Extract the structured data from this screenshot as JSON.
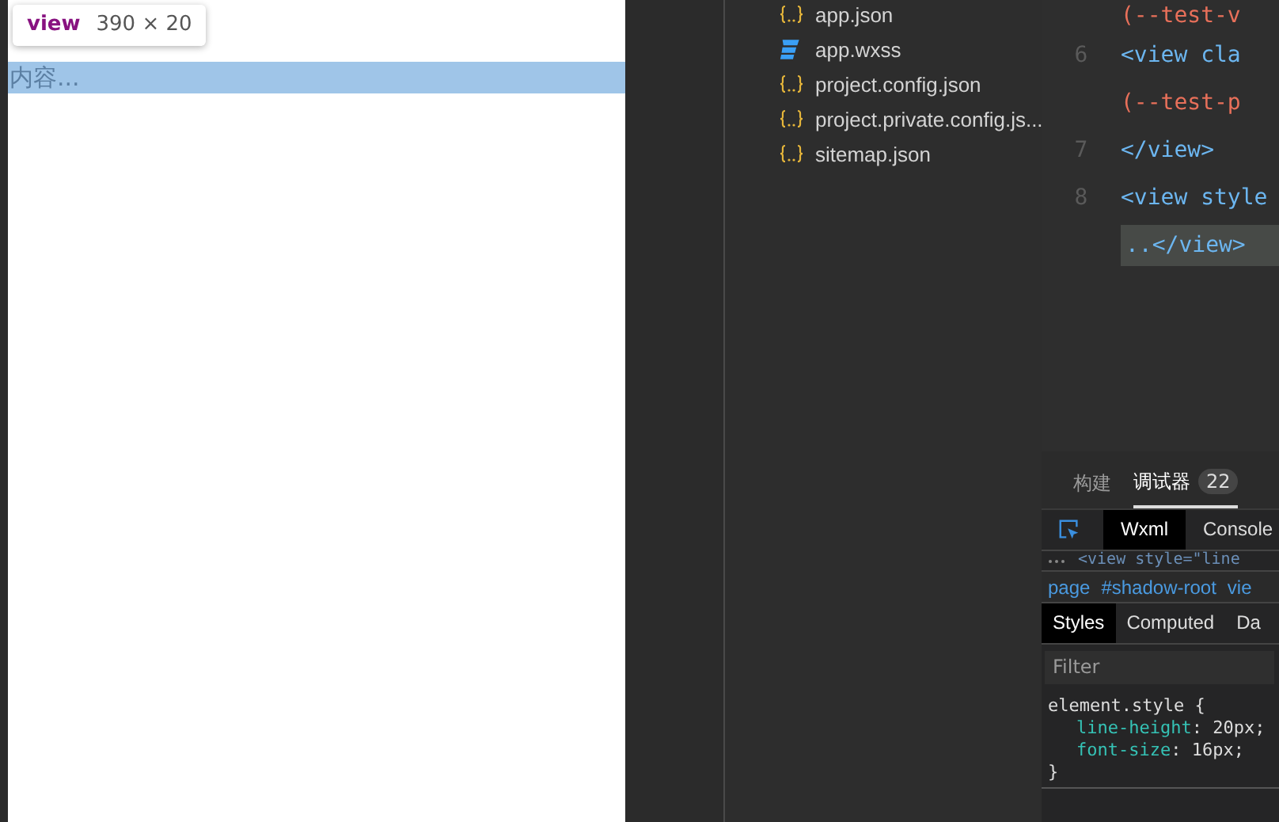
{
  "simulator": {
    "tooltip": {
      "tag": "view",
      "size": "390 × 20"
    },
    "element_text": "内容..."
  },
  "file_tree": {
    "items": [
      {
        "name": "app.json",
        "kind": "json"
      },
      {
        "name": "app.wxss",
        "kind": "css"
      },
      {
        "name": "project.config.json",
        "kind": "json"
      },
      {
        "name": "project.private.config.js...",
        "kind": "json"
      },
      {
        "name": "sitemap.json",
        "kind": "json"
      }
    ]
  },
  "editor": {
    "lines": [
      {
        "text": "(--test-v",
        "kind": "value",
        "highlighted": false
      },
      {
        "number": "6",
        "text": "<view cla",
        "kind": "tag",
        "highlighted": false
      },
      {
        "text": "(--test-p",
        "kind": "value",
        "highlighted": false
      },
      {
        "number": "7",
        "text": "</view>",
        "kind": "tag",
        "highlighted": false
      },
      {
        "number": "8",
        "text": "<view style",
        "kind": "tag",
        "highlighted": false
      },
      {
        "text": "..</view>",
        "kind": "tag",
        "highlighted": true
      }
    ]
  },
  "devtools": {
    "tabs": [
      {
        "label": "构建",
        "selected": false
      },
      {
        "label": "调试器",
        "selected": true,
        "badge": "22"
      }
    ],
    "panel_tabs": [
      {
        "label": "Wxml",
        "selected": true
      },
      {
        "label": "Console",
        "selected": false
      }
    ],
    "partial_line": "<view style=\"line",
    "breadcrumb": [
      "page",
      "#shadow-root",
      "vie"
    ],
    "style_tabs": [
      {
        "label": "Styles",
        "selected": true
      },
      {
        "label": "Computed",
        "selected": false
      },
      {
        "label": "Da",
        "selected": false
      }
    ],
    "filter": {
      "placeholder": "Filter"
    },
    "rule": {
      "selector": "element.style {",
      "declarations": [
        {
          "property": "line-height",
          "separator": ":",
          "value": "20px;"
        },
        {
          "property": "font-size",
          "separator": ":",
          "value": "16px;"
        }
      ],
      "close": "}"
    }
  }
}
